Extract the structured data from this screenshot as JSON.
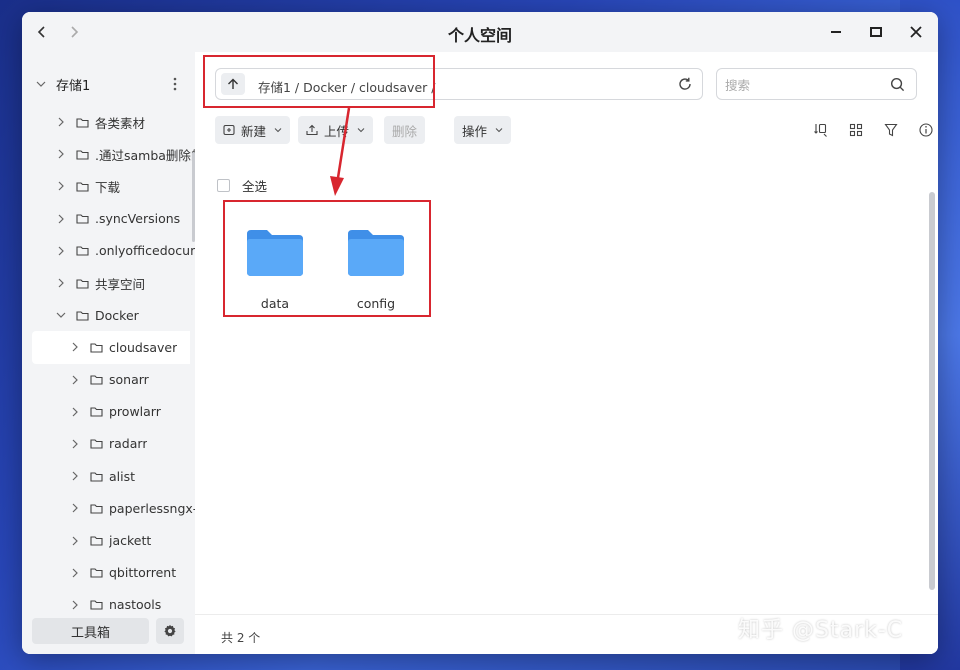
{
  "window": {
    "title": "个人空间"
  },
  "sidebar": {
    "root_label": "存储1",
    "items": [
      {
        "label": "各类素材",
        "level": 1
      },
      {
        "label": ".通过samba删除的",
        "level": 1
      },
      {
        "label": "下载",
        "level": 1
      },
      {
        "label": ".syncVersions",
        "level": 1
      },
      {
        "label": ".onlyofficedocum",
        "level": 1
      },
      {
        "label": "共享空间",
        "level": 1
      },
      {
        "label": "Docker",
        "level": 1,
        "expanded": true
      },
      {
        "label": "cloudsaver",
        "level": 2,
        "selected": true
      },
      {
        "label": "sonarr",
        "level": 2
      },
      {
        "label": "prowlarr",
        "level": 2
      },
      {
        "label": "radarr",
        "level": 2
      },
      {
        "label": "alist",
        "level": 2
      },
      {
        "label": "paperlessngx-",
        "level": 2
      },
      {
        "label": "jackett",
        "level": 2
      },
      {
        "label": "qbittorrent",
        "level": 2
      },
      {
        "label": "nastools",
        "level": 2
      }
    ],
    "toolbox_label": "工具箱"
  },
  "pathbar": {
    "path": "存储1 / Docker / cloudsaver /"
  },
  "search": {
    "placeholder": "搜索"
  },
  "toolbar": {
    "new_label": "新建",
    "upload_label": "上传",
    "delete_label": "删除",
    "actions_label": "操作"
  },
  "select_all_label": "全选",
  "files": [
    {
      "name": "data",
      "type": "folder"
    },
    {
      "name": "config",
      "type": "folder"
    }
  ],
  "status": {
    "count_text": "共 2 个"
  },
  "watermark": "知乎 @Stark-C",
  "colors": {
    "accent_red": "#d8262f",
    "folder_blue": "#5aa9f8",
    "sidebar_bg": "#f3f4f6"
  },
  "icons": [
    "back-icon",
    "forward-icon",
    "minimize-icon",
    "maximize-icon",
    "close-icon",
    "up-arrow-icon",
    "refresh-icon",
    "search-icon",
    "sort-icon",
    "grid-view-icon",
    "filter-icon",
    "info-icon",
    "gear-icon",
    "folder-icon"
  ]
}
